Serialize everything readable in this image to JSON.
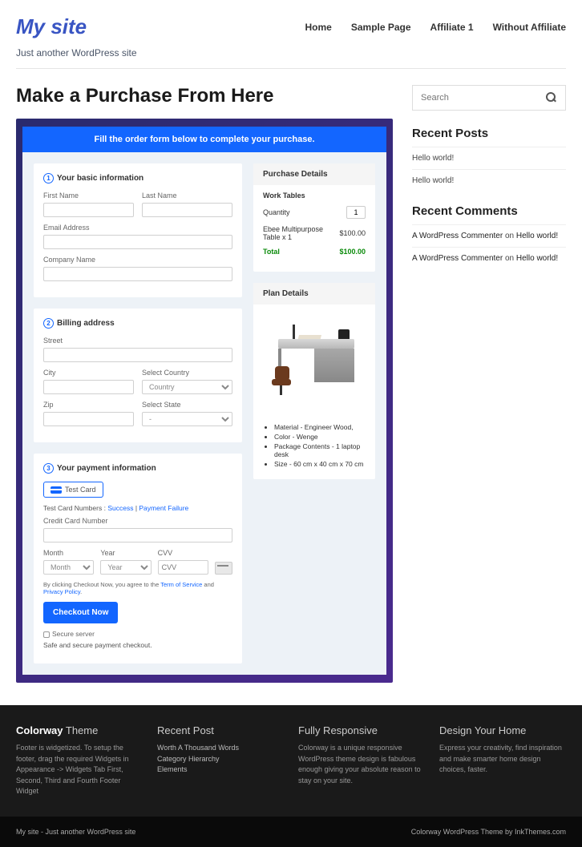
{
  "site": {
    "title": "My site",
    "tagline": "Just another WordPress site"
  },
  "nav": [
    "Home",
    "Sample Page",
    "Affiliate 1",
    "Without Affiliate"
  ],
  "page_title": "Make a Purchase From Here",
  "order": {
    "banner": "Fill the order form below to complete your purchase.",
    "basic": {
      "heading": "Your basic information",
      "first_name": "First Name",
      "last_name": "Last Name",
      "email": "Email Address",
      "company": "Company Name"
    },
    "billing": {
      "heading": "Billing address",
      "street": "Street",
      "city": "City",
      "country_lbl": "Select Country",
      "country_ph": "Country",
      "zip": "Zip",
      "state_lbl": "Select State",
      "state_ph": "-"
    },
    "payment": {
      "heading": "Your payment information",
      "test_card": "Test  Card",
      "test_numbers_lbl": "Test Card Numbers :",
      "success": "Success",
      "sep": " | ",
      "failure": "Payment Failure",
      "cc_label": "Credit Card Number",
      "month_lbl": "Month",
      "month_ph": "Month",
      "year_lbl": "Year",
      "year_ph": "Year",
      "cvv_lbl": "CVV",
      "cvv_ph": "CVV",
      "terms_pre": "By clicking Checkout Now, you agree to the ",
      "tos": "Term of Service",
      "and": " and ",
      "privacy": "Privacy Policy",
      "checkout": "Checkout Now",
      "secure": "Secure server",
      "safe": "Safe and secure payment checkout."
    },
    "purchase": {
      "heading": "Purchase Details",
      "sub": "Work Tables",
      "qty_lbl": "Quantity",
      "qty_val": "1",
      "item": "Ebee Multipurpose Table x 1",
      "price": "$100.00",
      "total_lbl": "Total",
      "total_val": "$100.00"
    },
    "plan": {
      "heading": "Plan Details",
      "bullets": [
        "Material - Engineer Wood,",
        "Color - Wenge",
        "Package Contents - 1 laptop desk",
        "Size - 60 cm x 40 cm x 70 cm"
      ]
    }
  },
  "sidebar": {
    "search_ph": "Search",
    "recent_posts": {
      "heading": "Recent Posts",
      "items": [
        "Hello world!",
        "Hello world!"
      ]
    },
    "recent_comments": {
      "heading": "Recent Comments",
      "items": [
        {
          "author": "A WordPress Commenter",
          "on": " on ",
          "post": "Hello world!"
        },
        {
          "author": "A WordPress Commenter",
          "on": " on ",
          "post": "Hello world!"
        }
      ]
    }
  },
  "footer": {
    "c1": {
      "b": "Colorway",
      "t": " Theme",
      "p": "Footer is widgetized. To setup the footer, drag the required Widgets in Appearance -> Widgets Tab First, Second, Third and Fourth Footer Widget"
    },
    "c2": {
      "t": "Recent Post",
      "l1": "Worth A Thousand Words",
      "l2": "Category Hierarchy",
      "l3": "Elements"
    },
    "c3": {
      "t": "Fully Responsive",
      "p": "Colorway is a unique responsive WordPress theme design is fabulous enough giving your absolute reason to stay on your site."
    },
    "c4": {
      "t": "Design Your Home",
      "p": "Express your creativity, find inspiration and make smarter home design choices, faster."
    }
  },
  "bottom": {
    "left": "My site - Just another WordPress site",
    "right": "Colorway WordPress Theme by InkThemes.com"
  }
}
